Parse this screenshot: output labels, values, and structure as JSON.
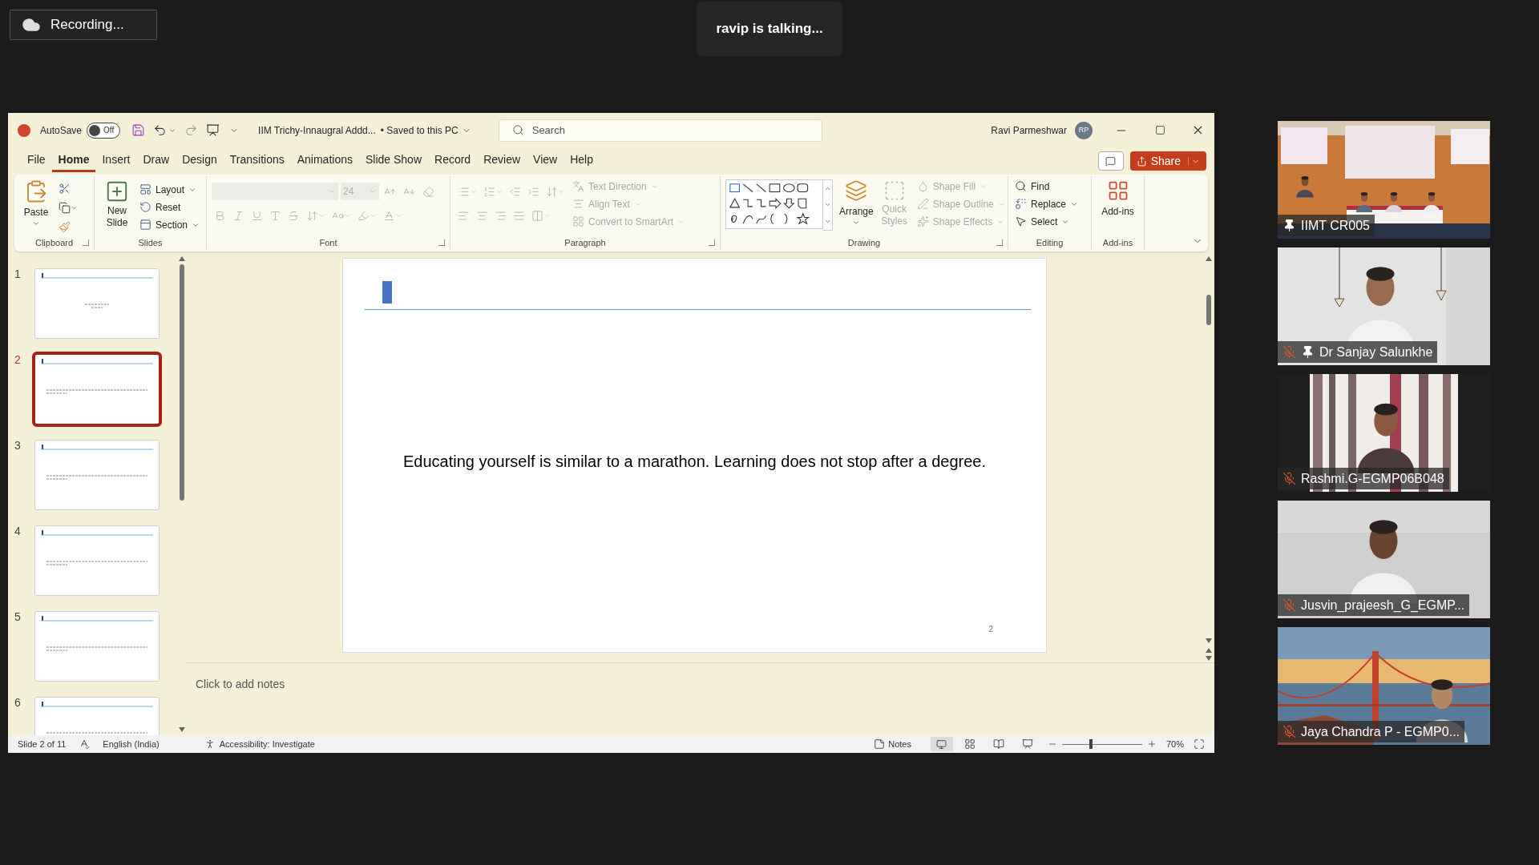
{
  "recording": {
    "label": "Recording..."
  },
  "speaker_banner": {
    "text": "ravip is talking..."
  },
  "window": {
    "autosave_label": "AutoSave",
    "autosave_on": false,
    "autosave_state": "Off",
    "file_title": "IIM Trichy-Innaugral Addd...",
    "save_status": "• Saved to this PC",
    "search_placeholder": "Search",
    "user_name": "Ravi Parmeshwar",
    "user_initials": "RP"
  },
  "menu_tabs": [
    {
      "label": "File",
      "selected": false
    },
    {
      "label": "Home",
      "selected": true
    },
    {
      "label": "Insert",
      "selected": false
    },
    {
      "label": "Draw",
      "selected": false
    },
    {
      "label": "Design",
      "selected": false
    },
    {
      "label": "Transitions",
      "selected": false
    },
    {
      "label": "Animations",
      "selected": false
    },
    {
      "label": "Slide Show",
      "selected": false
    },
    {
      "label": "Record",
      "selected": false
    },
    {
      "label": "Review",
      "selected": false
    },
    {
      "label": "View",
      "selected": false
    },
    {
      "label": "Help",
      "selected": false
    }
  ],
  "share_button": {
    "label": "Share"
  },
  "ribbon": {
    "clipboard": {
      "title": "Clipboard",
      "paste": "Paste"
    },
    "slides": {
      "title": "Slides",
      "new_slide": "New Slide",
      "layout": "Layout",
      "reset": "Reset",
      "section": "Section"
    },
    "font": {
      "title": "Font",
      "font_size": "24",
      "disabled": true
    },
    "paragraph": {
      "title": "Paragraph",
      "disabled": true,
      "text_direction": "Text Direction",
      "align_text": "Align Text",
      "convert": "Convert to SmartArt"
    },
    "drawing": {
      "title": "Drawing",
      "arrange": "Arrange",
      "quick_styles": "Quick Styles",
      "quick_styles_disabled": true,
      "shape_fill": "Shape Fill",
      "shape_outline": "Shape Outline",
      "shape_effects": "Shape Effects",
      "shape_format_disabled": true
    },
    "editing": {
      "title": "Editing",
      "find": "Find",
      "replace": "Replace",
      "select": "Select"
    },
    "addins": {
      "title": "Add-ins",
      "addins": "Add-ins"
    }
  },
  "thumbnails": [
    {
      "number": "1",
      "selected": false
    },
    {
      "number": "2",
      "selected": true
    },
    {
      "number": "3",
      "selected": false
    },
    {
      "number": "4",
      "selected": false
    },
    {
      "number": "5",
      "selected": false
    },
    {
      "number": "6",
      "selected": false
    }
  ],
  "slide": {
    "text": "Educating yourself is similar to a marathon. Learning does not stop after a degree.",
    "page_number": "2"
  },
  "notes": {
    "placeholder": "Click to add notes"
  },
  "status_bar": {
    "slide_info": "Slide 2 of 11",
    "language": "English (India)",
    "accessibility": "Accessibility: Investigate",
    "notes": "Notes",
    "zoom": "70%",
    "zoom_slider": {
      "level": 0.34
    }
  },
  "participants": [
    {
      "name": "IIMT CR005",
      "muted": false,
      "pinned": true
    },
    {
      "name": "Dr Sanjay Salunkhe",
      "muted": true,
      "pinned": true
    },
    {
      "name": "Rashmi.G-EGMP06B048",
      "muted": true,
      "pinned": false
    },
    {
      "name": "Jusvin_prajeesh_G_EGMP...",
      "muted": true,
      "pinned": false
    },
    {
      "name": "Jaya Chandra P - EGMP0...",
      "muted": true,
      "pinned": false
    }
  ]
}
